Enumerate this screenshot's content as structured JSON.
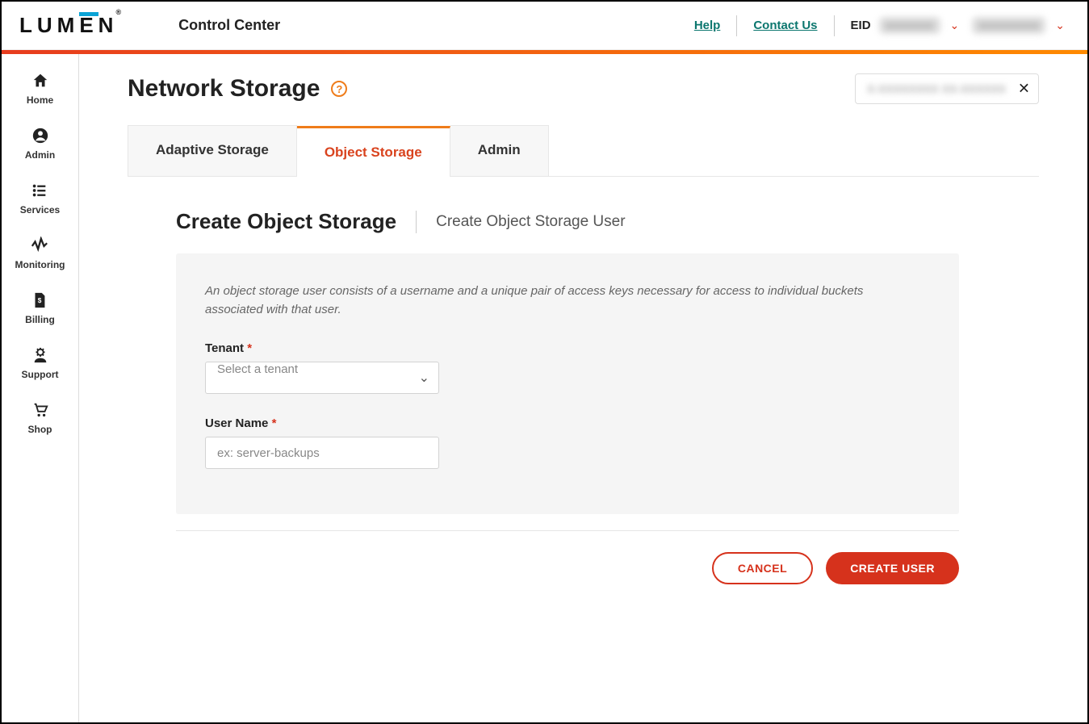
{
  "header": {
    "app_title": "Control Center",
    "help": "Help",
    "contact": "Contact Us",
    "eid_label": "EID"
  },
  "sidebar": {
    "items": [
      {
        "label": "Home",
        "icon": "home-icon"
      },
      {
        "label": "Admin",
        "icon": "user-circle-icon"
      },
      {
        "label": "Services",
        "icon": "list-icon"
      },
      {
        "label": "Monitoring",
        "icon": "activity-icon"
      },
      {
        "label": "Billing",
        "icon": "invoice-icon"
      },
      {
        "label": "Support",
        "icon": "gear-user-icon"
      },
      {
        "label": "Shop",
        "icon": "cart-icon"
      }
    ]
  },
  "page": {
    "title": "Network Storage",
    "tabs": [
      {
        "label": "Adaptive Storage",
        "active": false
      },
      {
        "label": "Object Storage",
        "active": true
      },
      {
        "label": "Admin",
        "active": false
      }
    ]
  },
  "subhead": {
    "title": "Create Object Storage",
    "desc": "Create Object Storage User"
  },
  "form": {
    "help_text": "An object storage user consists of a username and a unique pair of access keys necessary for access to individual buckets associated with that user.",
    "tenant_label": "Tenant",
    "tenant_placeholder": "Select a tenant",
    "username_label": "User Name",
    "username_placeholder": "ex: server-backups"
  },
  "actions": {
    "cancel": "CANCEL",
    "create": "CREATE USER"
  }
}
